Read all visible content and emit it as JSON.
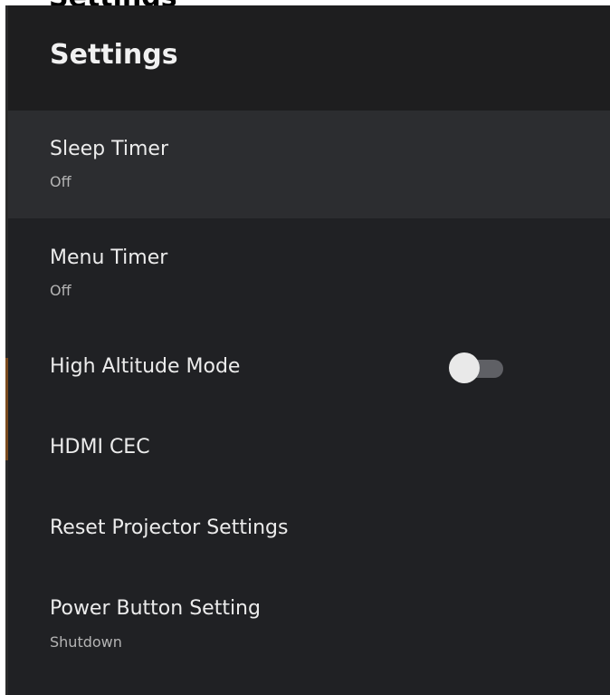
{
  "window": {
    "partial_title": "Settings"
  },
  "header": {
    "title": "Settings"
  },
  "settings": {
    "items": [
      {
        "label": "Sleep Timer",
        "value": "Off"
      },
      {
        "label": "Menu Timer",
        "value": "Off"
      },
      {
        "label": "High Altitude Mode",
        "toggle_state": "off"
      },
      {
        "label": "HDMI CEC"
      },
      {
        "label": "Reset Projector Settings"
      },
      {
        "label": "Power Button Setting",
        "value": "Shutdown"
      }
    ]
  },
  "colors": {
    "panel_background": "#202124",
    "header_background": "#1e1e1f",
    "focused_row": "#2c2d30",
    "primary_text": "#ececec",
    "secondary_text": "#b4b4b4",
    "toggle_knob": "#e9e9e9",
    "toggle_track": "#5f6065",
    "edge_accent": "#7a4a1e"
  }
}
